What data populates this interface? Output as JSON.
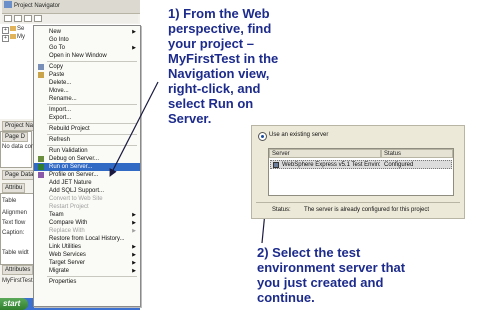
{
  "navigator": {
    "title": "Project Navigator",
    "tree": [
      {
        "label": "Se"
      },
      {
        "label": "My"
      }
    ]
  },
  "left_panes": {
    "project_nav_tab": "Project Nav",
    "page_d_tab": "Page D",
    "no_data_text": "No data conn",
    "page_data_tab": "Page Data",
    "attributes_tab": "Attribu",
    "table_tab": "Table",
    "alignment_label": "Alignmen",
    "text_flow_label": "Text flow",
    "caption_label": "Caption:",
    "table_width_label": "Table widt",
    "attributes2_tab": "Attributes",
    "myfirsttest_label": "MyFirstTest",
    "start_label": "start"
  },
  "context_menu": {
    "items": [
      {
        "label": "New",
        "submenu": true
      },
      {
        "label": "Go Into"
      },
      {
        "label": "Go To",
        "submenu": true
      },
      {
        "label": "Open in New Window"
      },
      {
        "sep": true
      },
      {
        "label": "Copy",
        "icon": "copy"
      },
      {
        "label": "Paste",
        "icon": "paste"
      },
      {
        "label": "Delete..."
      },
      {
        "label": "Move..."
      },
      {
        "label": "Rename..."
      },
      {
        "sep": true
      },
      {
        "label": "Import..."
      },
      {
        "label": "Export..."
      },
      {
        "sep": true
      },
      {
        "label": "Rebuild Project"
      },
      {
        "sep": true
      },
      {
        "label": "Refresh"
      },
      {
        "sep": true
      },
      {
        "label": "Run Validation"
      },
      {
        "label": "Debug on Server...",
        "icon": "debug"
      },
      {
        "label": "Run on Server...",
        "icon": "run",
        "highlighted": true
      },
      {
        "label": "Profile on Server...",
        "icon": "profile"
      },
      {
        "label": "Add JET Nature"
      },
      {
        "label": "Add SQLJ Support..."
      },
      {
        "label": "Convert to Web Site",
        "disabled": true
      },
      {
        "label": "Restart Project",
        "disabled": true
      },
      {
        "label": "Team",
        "submenu": true
      },
      {
        "label": "Compare With",
        "submenu": true
      },
      {
        "label": "Replace With",
        "submenu": true,
        "disabled": true
      },
      {
        "label": "Restore from Local History..."
      },
      {
        "label": "Link Utilities",
        "submenu": true
      },
      {
        "label": "Web Services",
        "submenu": true
      },
      {
        "label": "Target Server",
        "submenu": true
      },
      {
        "label": "Migrate",
        "submenu": true
      },
      {
        "sep": true
      },
      {
        "label": "Properties"
      }
    ]
  },
  "annotation1": {
    "lines": [
      "1) From the Web",
      "perspective, find",
      "your project –",
      "MyFirstTest in the",
      "Navigation view,",
      "right-click, and",
      "select Run on",
      "Server."
    ]
  },
  "dialog": {
    "radio_label": "Use an existing server",
    "col_server": "Server",
    "col_status": "Status",
    "row_server": "WebSphere Express v5.1 Test Environ...",
    "row_status": "Configured",
    "status_label": "Status:",
    "status_text": "The server is already configured for this project"
  },
  "annotation2": {
    "lines": [
      "2) Select the test",
      "environment server that",
      "you just created and",
      "continue."
    ]
  },
  "colors": {
    "annotation_text": "#1d2c8c",
    "menu_highlight": "#316ac5",
    "arrow": "#1a1a40"
  }
}
